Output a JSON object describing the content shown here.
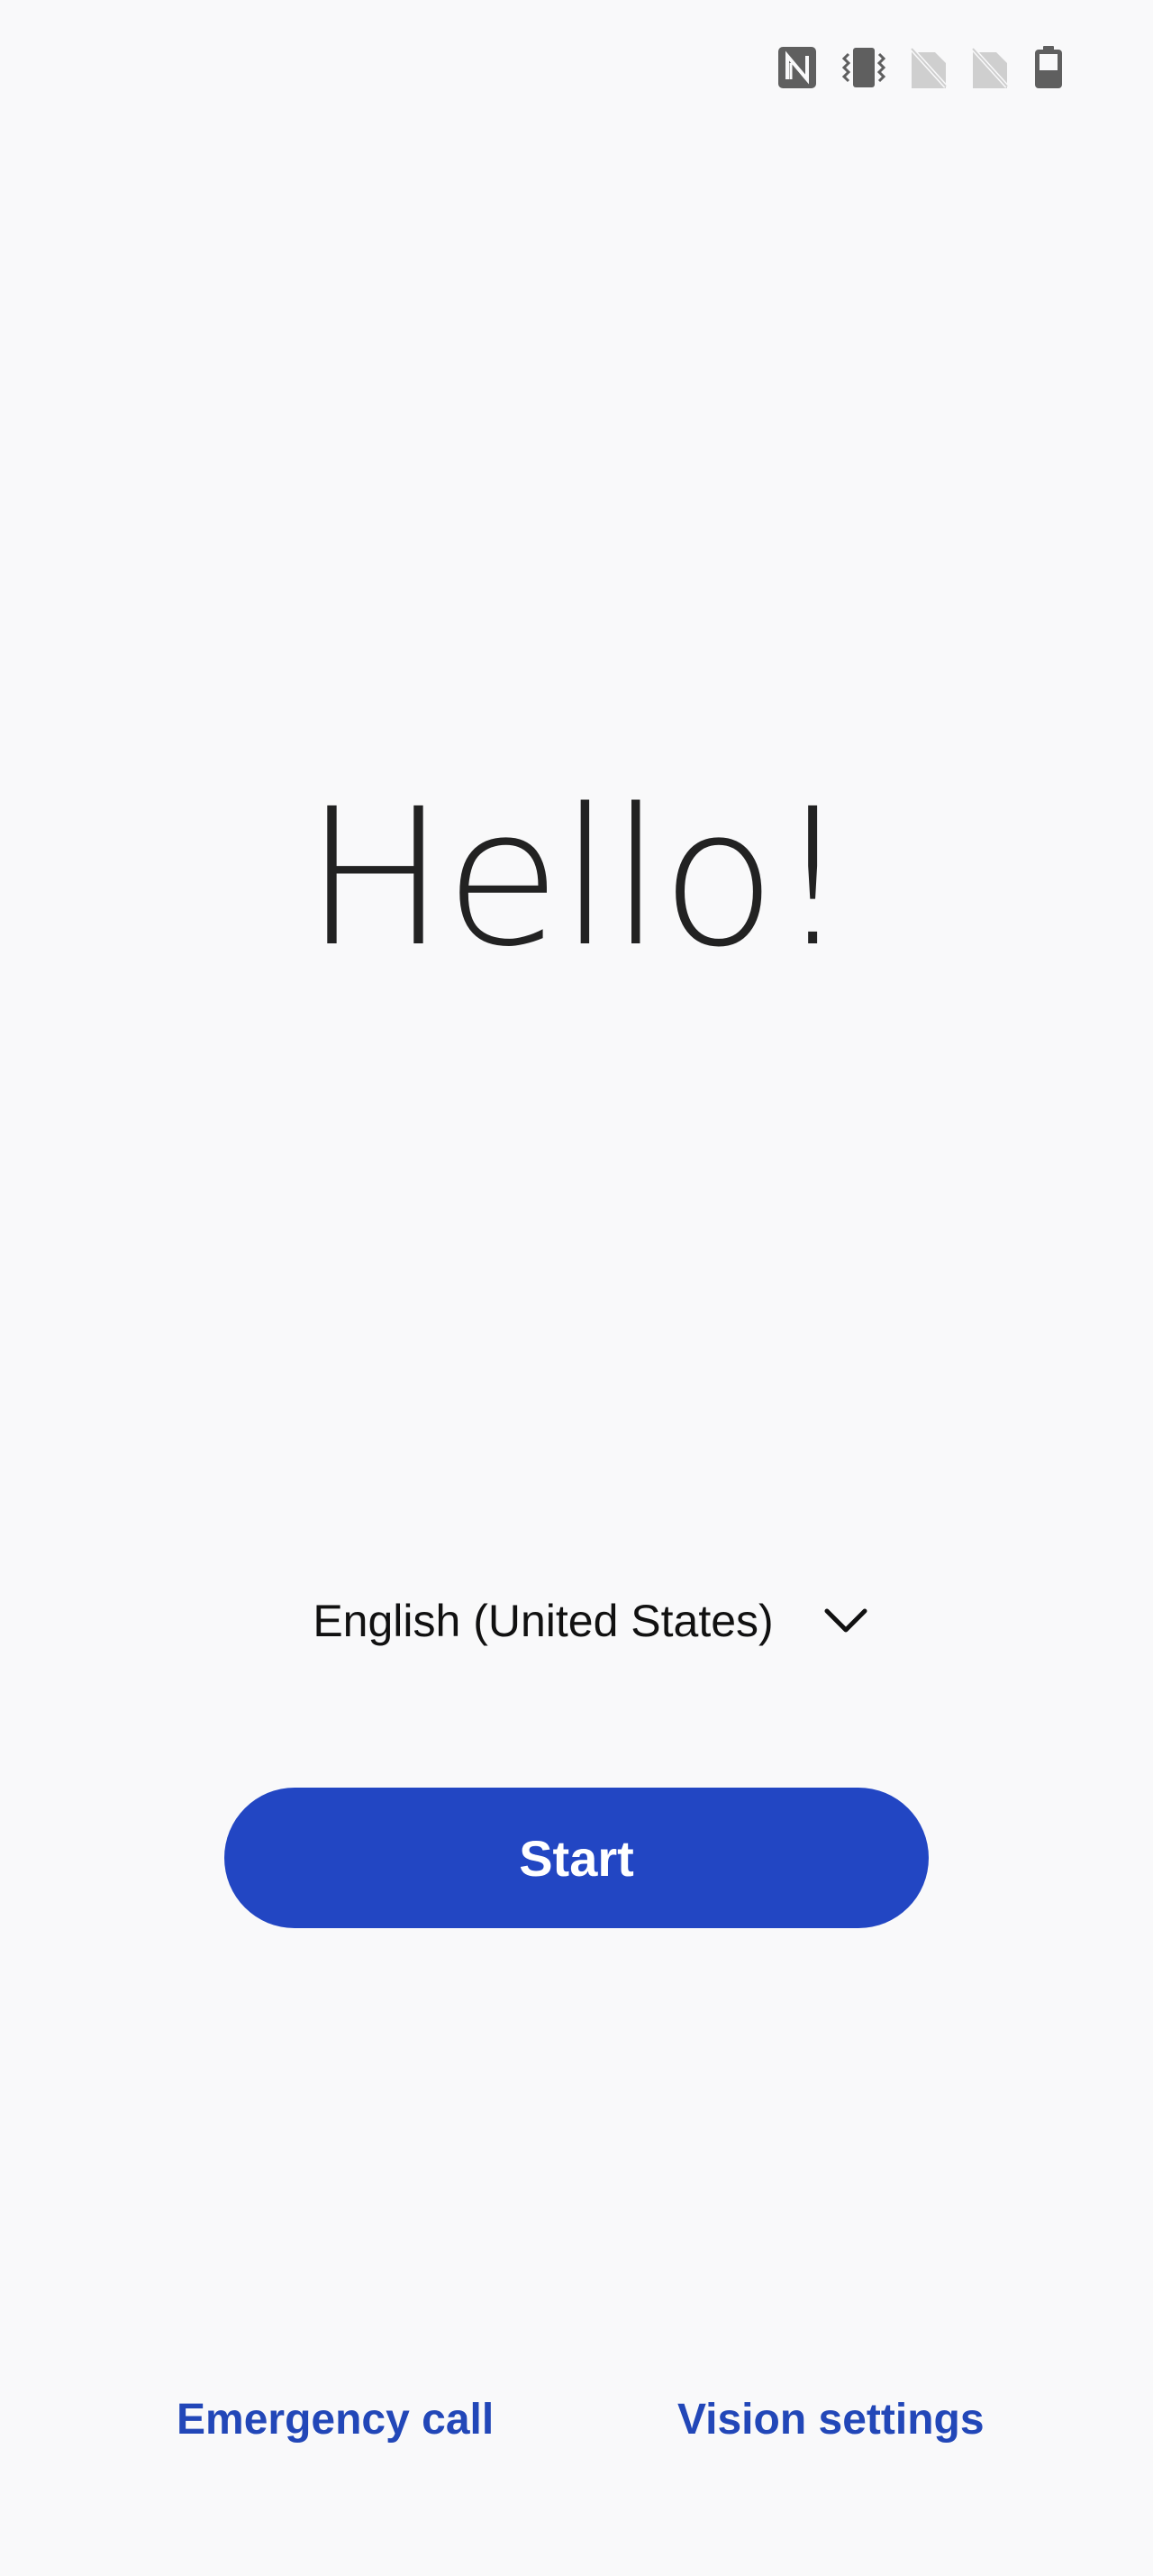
{
  "status_bar": {
    "icons": [
      "nfc-icon",
      "vibrate-icon",
      "no-sim-icon",
      "no-sim-icon",
      "battery-icon"
    ]
  },
  "welcome": {
    "greeting": "Hello!"
  },
  "language": {
    "selected": "English (United States)"
  },
  "actions": {
    "start_label": "Start",
    "emergency_call_label": "Emergency call",
    "vision_settings_label": "Vision settings"
  },
  "colors": {
    "accent": "#2246c3",
    "link": "#2247b8",
    "background": "#f9f9fa"
  }
}
